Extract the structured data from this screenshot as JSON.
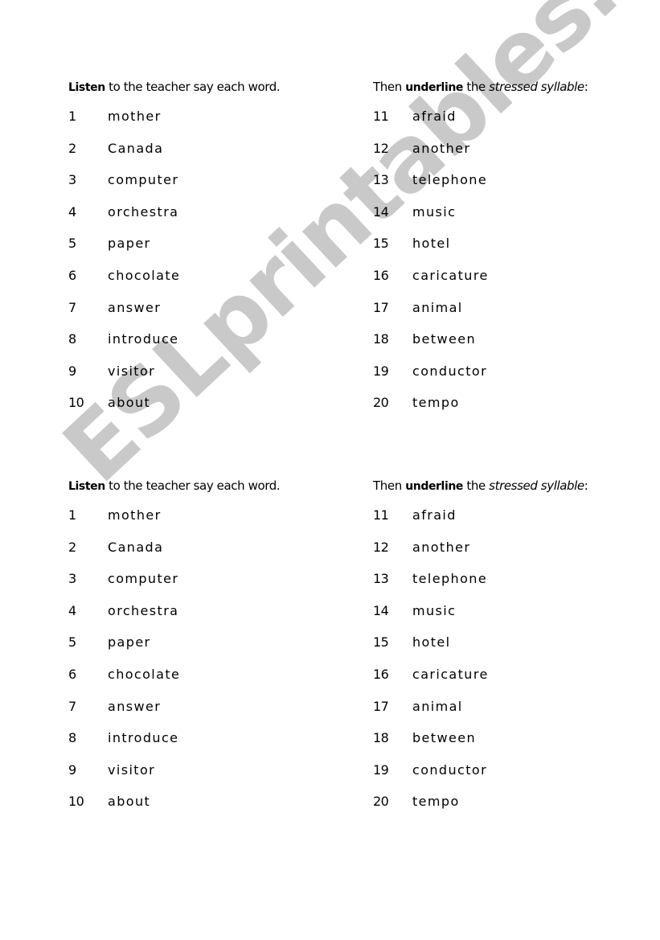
{
  "watermark": {
    "text": "ESLprintables.com",
    "color": "#c9c9c9"
  },
  "sections": [
    {
      "left_instruction": {
        "bold": "Listen",
        "rest": " to the teacher say each word."
      },
      "right_instruction": {
        "prefix": "Then ",
        "bold": "underline",
        "middle": " the ",
        "italic": "stressed syllable",
        "suffix": ":"
      },
      "left_items": [
        {
          "num": "1",
          "word": "mother"
        },
        {
          "num": "2",
          "word": "Canada"
        },
        {
          "num": "3",
          "word": "computer"
        },
        {
          "num": "4",
          "word": "orchestra"
        },
        {
          "num": "5",
          "word": "paper"
        },
        {
          "num": "6",
          "word": "chocolate"
        },
        {
          "num": "7",
          "word": "answer"
        },
        {
          "num": "8",
          "word": "introduce"
        },
        {
          "num": "9",
          "word": "visitor"
        },
        {
          "num": "10",
          "word": "about"
        }
      ],
      "right_items": [
        {
          "num": "11",
          "word": "afraid"
        },
        {
          "num": "12",
          "word": "another"
        },
        {
          "num": "13",
          "word": "telephone"
        },
        {
          "num": "14",
          "word": "music"
        },
        {
          "num": "15",
          "word": "hotel"
        },
        {
          "num": "16",
          "word": "caricature"
        },
        {
          "num": "17",
          "word": "animal"
        },
        {
          "num": "18",
          "word": "between"
        },
        {
          "num": "19",
          "word": "conductor"
        },
        {
          "num": "20",
          "word": "tempo"
        }
      ]
    },
    {
      "left_instruction": {
        "bold": "Listen",
        "rest": " to the teacher say each word."
      },
      "right_instruction": {
        "prefix": "Then ",
        "bold": "underline",
        "middle": " the ",
        "italic": "stressed syllable",
        "suffix": ":"
      },
      "left_items": [
        {
          "num": "1",
          "word": "mother"
        },
        {
          "num": "2",
          "word": "Canada"
        },
        {
          "num": "3",
          "word": "computer"
        },
        {
          "num": "4",
          "word": "orchestra"
        },
        {
          "num": "5",
          "word": "paper"
        },
        {
          "num": "6",
          "word": "chocolate"
        },
        {
          "num": "7",
          "word": "answer"
        },
        {
          "num": "8",
          "word": "introduce"
        },
        {
          "num": "9",
          "word": "visitor"
        },
        {
          "num": "10",
          "word": "about"
        }
      ],
      "right_items": [
        {
          "num": "11",
          "word": "afraid"
        },
        {
          "num": "12",
          "word": "another"
        },
        {
          "num": "13",
          "word": "telephone"
        },
        {
          "num": "14",
          "word": "music"
        },
        {
          "num": "15",
          "word": "hotel"
        },
        {
          "num": "16",
          "word": "caricature"
        },
        {
          "num": "17",
          "word": "animal"
        },
        {
          "num": "18",
          "word": "between"
        },
        {
          "num": "19",
          "word": "conductor"
        },
        {
          "num": "20",
          "word": "tempo"
        }
      ]
    }
  ]
}
